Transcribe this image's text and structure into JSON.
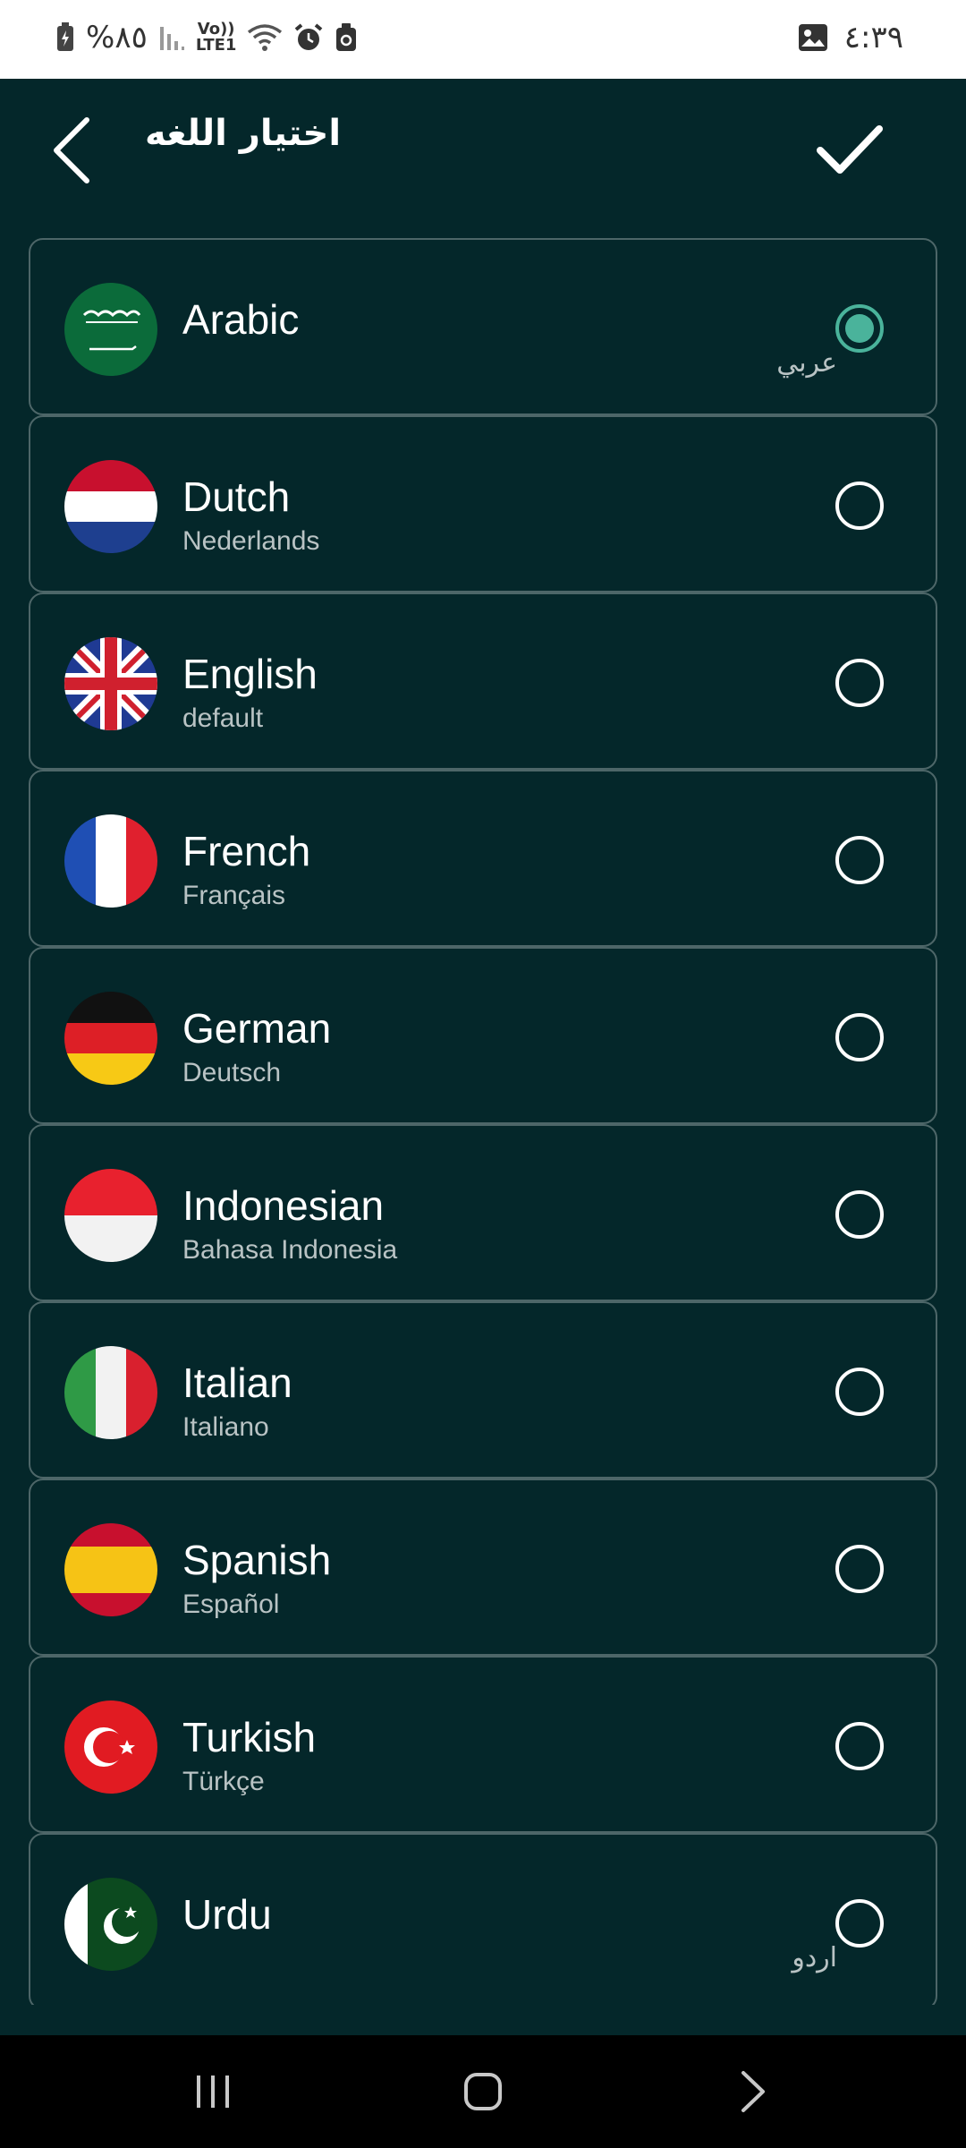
{
  "status_bar": {
    "battery_text": "%٨٥",
    "network_top": "Vo))",
    "network_bottom": "LTE1",
    "time": "٤:٣٩"
  },
  "app_bar": {
    "title": "اختيار اللغه",
    "back_icon": "chevron-left-icon",
    "confirm_icon": "check-icon"
  },
  "colors": {
    "background": "#04272a",
    "card_border": "#4d6668",
    "radio_selected": "#4ab39b"
  },
  "languages": [
    {
      "name": "Arabic",
      "native": "عربي",
      "selected": true
    },
    {
      "name": "Dutch",
      "native": "Nederlands",
      "selected": false
    },
    {
      "name": "English",
      "native": "default",
      "selected": false
    },
    {
      "name": "French",
      "native": "Français",
      "selected": false
    },
    {
      "name": "German",
      "native": "Deutsch",
      "selected": false
    },
    {
      "name": "Indonesian",
      "native": "Bahasa Indonesia",
      "selected": false
    },
    {
      "name": "Italian",
      "native": "Italiano",
      "selected": false
    },
    {
      "name": "Spanish",
      "native": "Español",
      "selected": false
    },
    {
      "name": "Turkish",
      "native": "Türkçe",
      "selected": false
    },
    {
      "name": "Urdu",
      "native": "اردو",
      "selected": false
    }
  ]
}
